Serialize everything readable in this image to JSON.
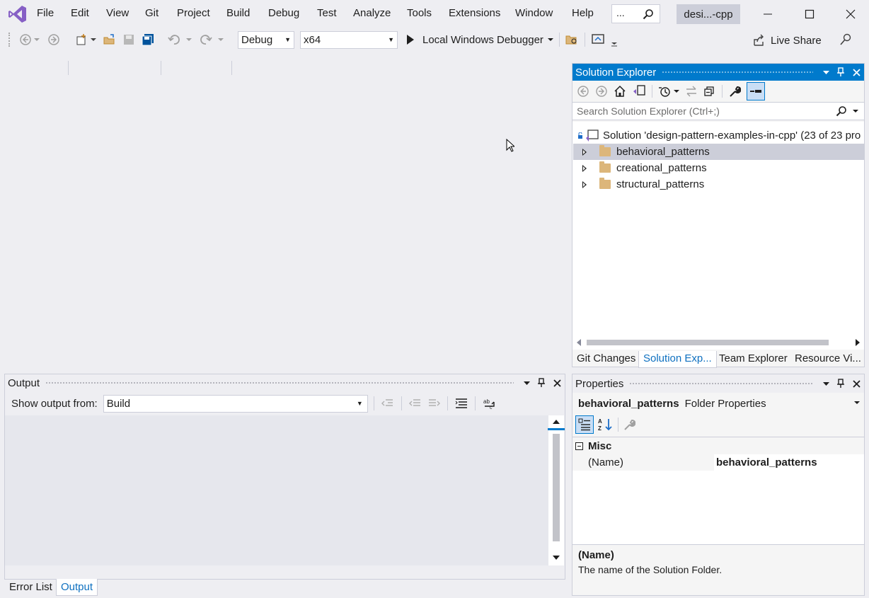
{
  "menu": {
    "items": [
      "File",
      "Edit",
      "View",
      "Git",
      "Project",
      "Build",
      "Debug",
      "Test",
      "Analyze",
      "Tools",
      "Extensions",
      "Window",
      "Help"
    ],
    "search_placeholder": "...",
    "solution_name": "desi...-cpp"
  },
  "toolbar": {
    "config": "Debug",
    "platform": "x64",
    "run_label": "Local Windows Debugger",
    "live_share": "Live Share"
  },
  "solution_explorer": {
    "title": "Solution Explorer",
    "search_placeholder": "Search Solution Explorer (Ctrl+;)",
    "solution_label": "Solution 'design-pattern-examples-in-cpp' (23 of 23 pro",
    "items": [
      "behavioral_patterns",
      "creational_patterns",
      "structural_patterns"
    ],
    "tabs": [
      "Git Changes",
      "Solution Exp...",
      "Team Explorer",
      "Resource Vi..."
    ]
  },
  "output": {
    "title": "Output",
    "show_from_label": "Show output from:",
    "show_from_value": "Build",
    "tabs": [
      "Error List",
      "Output"
    ]
  },
  "properties": {
    "title": "Properties",
    "object_name": "behavioral_patterns",
    "object_type": "Folder Properties",
    "category": "Misc",
    "prop_name": "(Name)",
    "prop_value": "behavioral_patterns",
    "desc_title": "(Name)",
    "desc_text": "The name of the Solution Folder."
  },
  "colors": {
    "accent": "#007acc",
    "background": "#eeeef2",
    "selection": "#ccced9",
    "vs_purple": "#865fc5"
  }
}
